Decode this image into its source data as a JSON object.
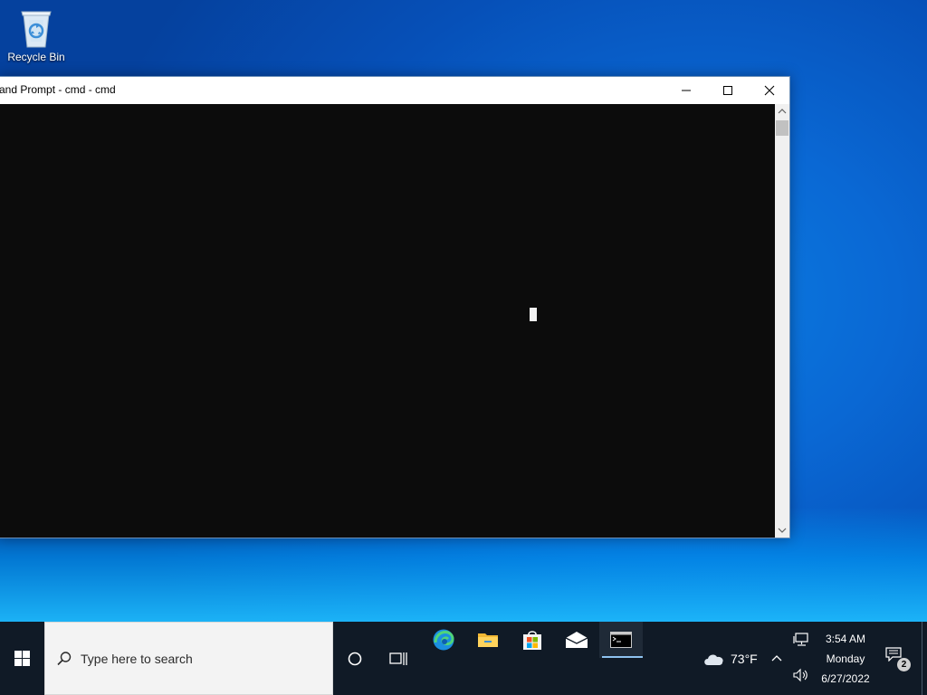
{
  "desktop": {
    "icons": [
      {
        "label": "Recycle Bin",
        "icon": "recycle-bin-icon"
      }
    ]
  },
  "window": {
    "title": "and Prompt - cmd - cmd",
    "controls": {
      "minimize": "minimize-icon",
      "maximize": "maximize-icon",
      "close": "close-icon"
    },
    "console": {
      "background": "#0c0c0c",
      "cursor_color": "#f2f2f2"
    }
  },
  "taskbar": {
    "start_icon": "windows-logo-icon",
    "search": {
      "placeholder": "Type here to search"
    },
    "pinned": [
      {
        "name": "edge",
        "icon": "edge-icon"
      },
      {
        "name": "file-explorer",
        "icon": "folder-icon"
      },
      {
        "name": "microsoft-store",
        "icon": "store-icon"
      },
      {
        "name": "mail",
        "icon": "mail-icon"
      },
      {
        "name": "command-prompt",
        "icon": "cmd-icon",
        "active": true
      }
    ],
    "weather": {
      "icon": "cloud-icon",
      "temperature": "73°F"
    },
    "clock": {
      "time": "3:54 AM",
      "day": "Monday",
      "date": "6/27/2022"
    },
    "notifications": {
      "count": "2"
    }
  },
  "colors": {
    "taskbar_bg": "#101a26",
    "active_indicator": "#8fc3f0",
    "desktop_accent": "#0a68d4"
  }
}
